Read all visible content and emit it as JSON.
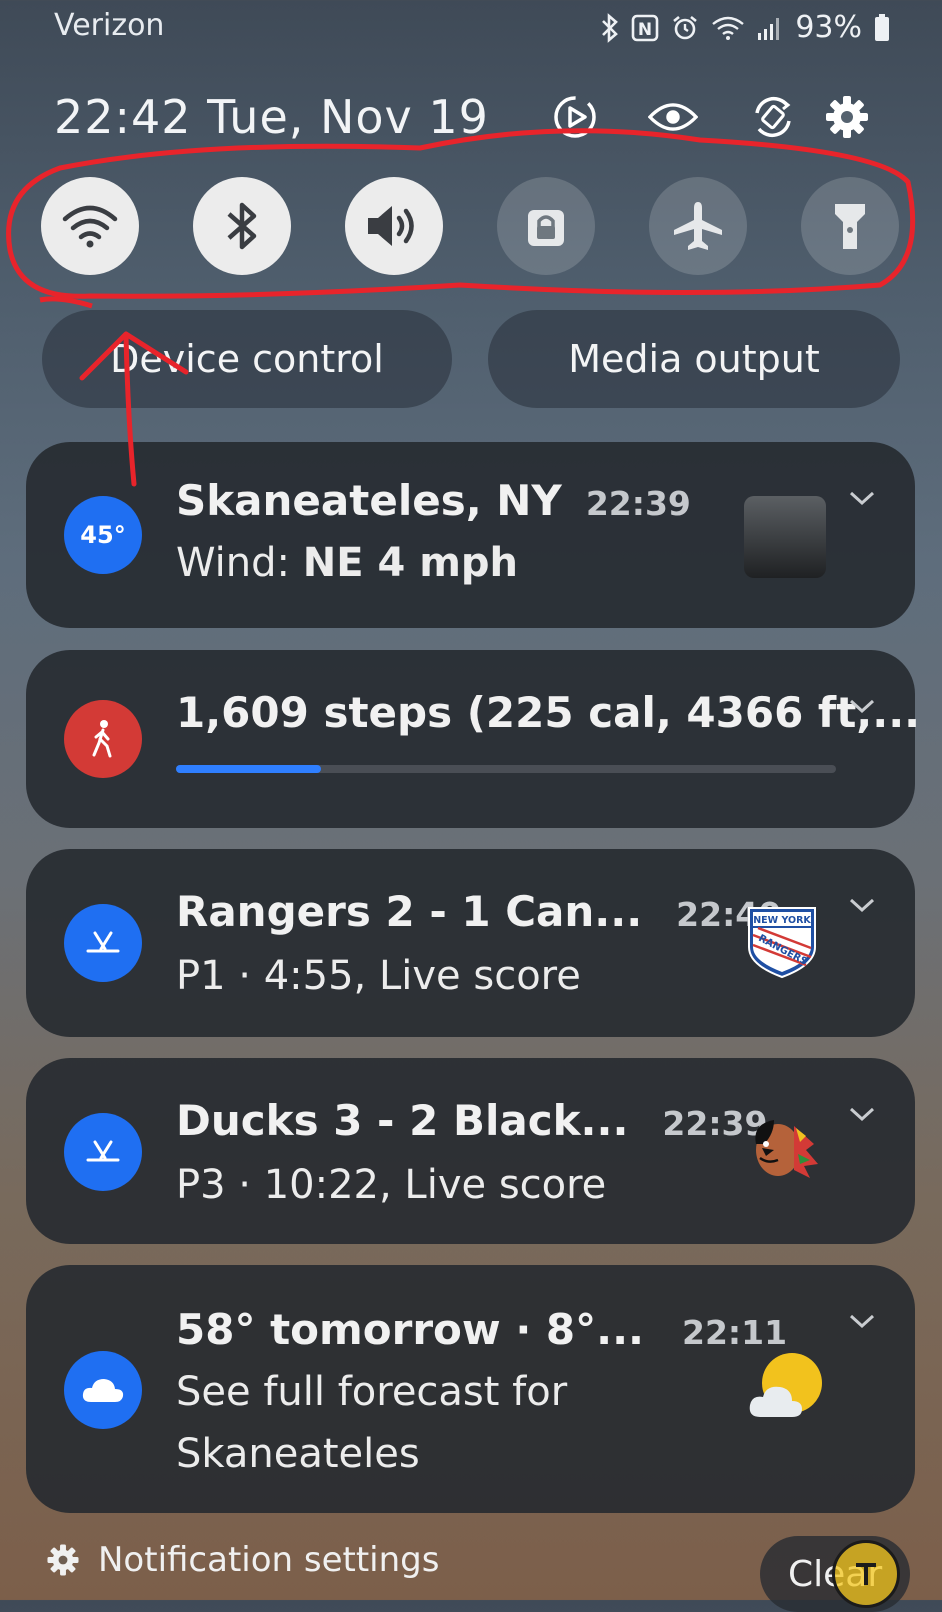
{
  "status_bar": {
    "carrier": "Verizon",
    "battery": "93%",
    "icons": [
      "bluetooth-icon",
      "nfc-icon",
      "alarm-icon",
      "wifi-calling-icon",
      "signal-icon",
      "battery-icon"
    ]
  },
  "header": {
    "datetime": "22:42 Tue, Nov 19",
    "icons": [
      "screen-recorder-icon",
      "eye-comfort-icon",
      "auto-rotate-icon",
      "settings-icon"
    ]
  },
  "quick_tiles": [
    {
      "name": "wifi",
      "state": "on"
    },
    {
      "name": "bluetooth",
      "state": "on"
    },
    {
      "name": "sound",
      "state": "on"
    },
    {
      "name": "secure-folder",
      "state": "off"
    },
    {
      "name": "airplane-mode",
      "state": "off"
    },
    {
      "name": "flashlight",
      "state": "off"
    }
  ],
  "buttons": {
    "device_control": "Device control",
    "media_output": "Media output"
  },
  "notifications": {
    "weather": {
      "icon_text": "45°",
      "title": "Skaneateles, NY",
      "time": "22:39",
      "sub_label": "Wind: ",
      "sub_value": "NE 4 mph"
    },
    "steps": {
      "title": "1,609 steps (225 cal, 4366 ft,...",
      "progress": 0.22
    },
    "rangers": {
      "title": "Rangers 2 - 1 Can...",
      "time": "22:40",
      "sub": "P1 · 4:55, Live score",
      "logo_text": "NEW YORK RANGERS"
    },
    "ducks": {
      "title": "Ducks 3 - 2 Black...",
      "time": "22:39",
      "sub": "P3 · 10:22, Live score"
    },
    "forecast": {
      "title": "58° tomorrow · 8°...",
      "time": "22:11",
      "sub_line1": "See full forecast for",
      "sub_line2": "Skaneateles"
    }
  },
  "footer": {
    "settings_label": "Notification settings",
    "clear_label": "Clear"
  },
  "colors": {
    "accent": "#2f7fff",
    "annotation": "#e8242b",
    "app_blue": "#1f6ff2",
    "app_red": "#d33a36"
  }
}
